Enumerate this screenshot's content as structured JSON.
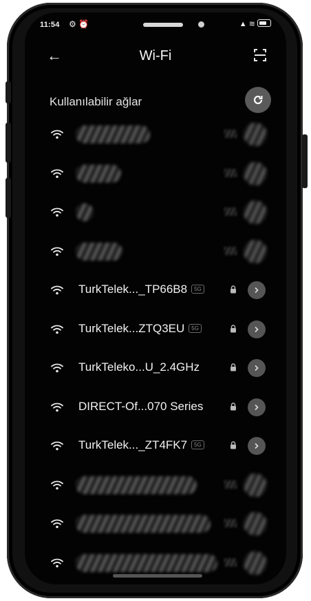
{
  "status_bar": {
    "time": "11:54",
    "left_icons": "⚙ ⏰",
    "right_icons": "▲ ≋"
  },
  "header": {
    "back_icon": "←",
    "title": "Wi-Fi",
    "scan_icon": "qr-scan-icon"
  },
  "section": {
    "label": "Kullanılabilir ağlar",
    "refresh_icon": "refresh-icon"
  },
  "networks": [
    {
      "ssid": "",
      "obscured": true,
      "blur_width": 108,
      "secured": true
    },
    {
      "ssid": "",
      "obscured": true,
      "blur_width": 66,
      "secured": true
    },
    {
      "ssid": "",
      "obscured": true,
      "blur_width": 26,
      "secured": true
    },
    {
      "ssid": "",
      "obscured": true,
      "blur_width": 68,
      "secured": true
    },
    {
      "ssid": "TurkTelek..._TP66B8",
      "badge": "5G",
      "secured": true,
      "obscured": false
    },
    {
      "ssid": "TurkTelek...ZTQ3EU",
      "badge": "5G",
      "secured": true,
      "obscured": false
    },
    {
      "ssid": "TurkTeleko...U_2.4GHz",
      "badge": "",
      "secured": true,
      "obscured": false
    },
    {
      "ssid": "DIRECT-Of...070 Series",
      "badge": "",
      "secured": true,
      "obscured": false
    },
    {
      "ssid": "TurkTelek..._ZT4FK7",
      "badge": "5G",
      "secured": true,
      "obscured": false
    },
    {
      "ssid": "",
      "obscured": true,
      "blur_width": 176,
      "secured": true
    },
    {
      "ssid": "",
      "obscured": true,
      "blur_width": 196,
      "secured": true
    },
    {
      "ssid": "",
      "obscured": true,
      "blur_width": 206,
      "secured": true
    }
  ],
  "colors": {
    "background": "#030303",
    "text": "#f2f2f2",
    "info_button": "#555555",
    "refresh_button": "#5a5a5a"
  }
}
